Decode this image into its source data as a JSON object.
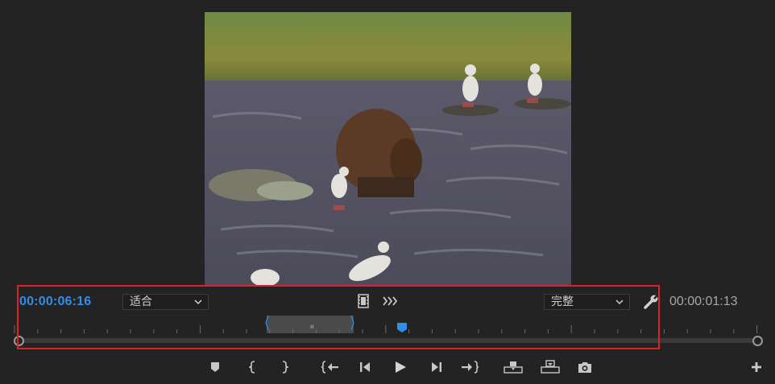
{
  "monitor": {
    "current_timecode": "00:00:06:16",
    "duration_timecode": "00:00:01:13",
    "zoom_select": {
      "value": "适合"
    },
    "resolution_select": {
      "value": "完整"
    }
  },
  "colors": {
    "timecode_accent": "#2e8ee8",
    "playhead": "#2e8ee8",
    "highlight_border": "#e0202a"
  },
  "icons": {
    "export_frame": "film-icon",
    "insert_settings": "arrows-icon",
    "settings": "wrench-icon"
  },
  "transport": [
    "add-marker-icon",
    "mark-in-icon",
    "mark-out-icon",
    "go-to-in-icon",
    "step-back-icon",
    "play-icon",
    "step-forward-icon",
    "go-to-out-icon",
    "insert-icon",
    "overwrite-icon",
    "export-frame-icon",
    "add-button-icon"
  ]
}
